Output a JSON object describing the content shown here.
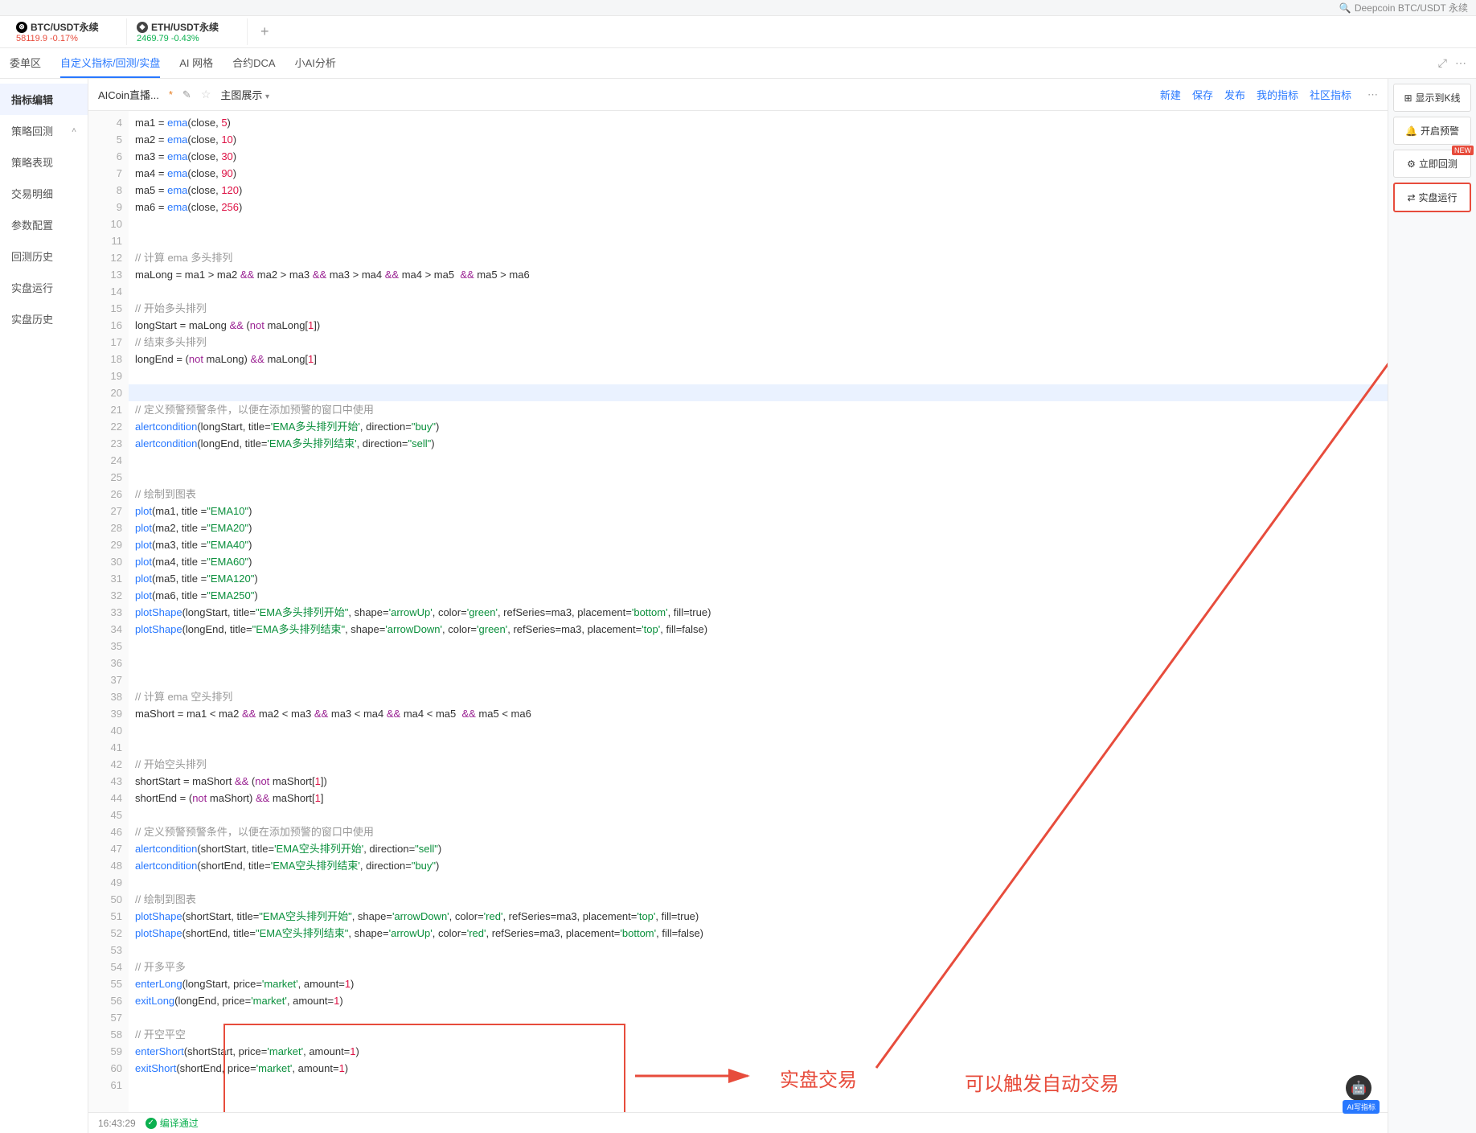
{
  "search": {
    "placeholder": "Deepcoin BTC/USDT 永续"
  },
  "pairs": [
    {
      "name": "BTC/USDT永续",
      "price": "58119.9",
      "change": "-0.17%",
      "cls": "red"
    },
    {
      "name": "ETH/USDT永续",
      "price": "2469.79",
      "change": "-0.43%",
      "cls": "green"
    }
  ],
  "menu": {
    "items": [
      "委单区",
      "自定义指标/回测/实盘",
      "AI 网格",
      "合约DCA",
      "小AI分析"
    ],
    "activeIndex": 1
  },
  "sidebar": {
    "items": [
      "指标编辑",
      "策略回测",
      "策略表现",
      "交易明细",
      "参数配置",
      "回测历史",
      "实盘运行",
      "实盘历史"
    ],
    "activeIndex": 0,
    "expandIndex": 1
  },
  "toolbar": {
    "title": "AICoin直播...",
    "modified": "*",
    "mainChart": "主图展示",
    "actions": [
      "新建",
      "保存",
      "发布",
      "我的指标",
      "社区指标"
    ]
  },
  "rightPanel": {
    "buttons": [
      {
        "icon": "⊞",
        "label": "显示到K线"
      },
      {
        "icon": "🔔",
        "label": "开启预警"
      },
      {
        "icon": "⚙",
        "label": "立即回测",
        "badge": "NEW"
      },
      {
        "icon": "⇄",
        "label": "实盘运行",
        "boxed": true
      }
    ]
  },
  "status": {
    "time": "16:43:29",
    "compile": "编译通过"
  },
  "annotations": {
    "text1": "实盘交易",
    "text2": "可以触发自动交易"
  },
  "floatBot": "AI写指标",
  "code": {
    "startLine": 4,
    "lines": [
      {
        "n": 4,
        "t": "ma1 = <fn>ema</fn>(close, <num>5</num>)"
      },
      {
        "n": 5,
        "t": "ma2 = <fn>ema</fn>(close, <num>10</num>)"
      },
      {
        "n": 6,
        "t": "ma3 = <fn>ema</fn>(close, <num>30</num>)"
      },
      {
        "n": 7,
        "t": "ma4 = <fn>ema</fn>(close, <num>90</num>)"
      },
      {
        "n": 8,
        "t": "ma5 = <fn>ema</fn>(close, <num>120</num>)"
      },
      {
        "n": 9,
        "t": "ma6 = <fn>ema</fn>(close, <num>256</num>)"
      },
      {
        "n": 10,
        "t": ""
      },
      {
        "n": 11,
        "t": ""
      },
      {
        "n": 12,
        "t": "<cm>// 计算 ema 多头排列</cm>"
      },
      {
        "n": 13,
        "t": "maLong = ma1 > ma2 <kw>&&</kw> ma2 > ma3 <kw>&&</kw> ma3 > ma4 <kw>&&</kw> ma4 > ma5  <kw>&&</kw> ma5 > ma6"
      },
      {
        "n": 14,
        "t": ""
      },
      {
        "n": 15,
        "t": "<cm>// 开始多头排列</cm>"
      },
      {
        "n": 16,
        "t": "longStart = maLong <kw>&&</kw> (<kw>not</kw> maLong[<num>1</num>])"
      },
      {
        "n": 17,
        "t": "<cm>// 结束多头排列</cm>"
      },
      {
        "n": 18,
        "t": "longEnd = (<kw>not</kw> maLong) <kw>&&</kw> maLong[<num>1</num>]"
      },
      {
        "n": 19,
        "t": ""
      },
      {
        "n": 20,
        "t": "",
        "hl": true
      },
      {
        "n": 21,
        "t": "<cm>// 定义预警预警条件，以便在添加预警的窗口中使用</cm>"
      },
      {
        "n": 22,
        "t": "<fn>alertcondition</fn>(longStart, title=<str>'EMA多头排列开始'</str>, direction=<str>\"buy\"</str>)"
      },
      {
        "n": 23,
        "t": "<fn>alertcondition</fn>(longEnd, title=<str>'EMA多头排列结束'</str>, direction=<str>\"sell\"</str>)"
      },
      {
        "n": 24,
        "t": ""
      },
      {
        "n": 25,
        "t": ""
      },
      {
        "n": 26,
        "t": "<cm>// 绘制到图表</cm>"
      },
      {
        "n": 27,
        "t": "<fn>plot</fn>(ma1, title =<str>\"EMA10\"</str>)"
      },
      {
        "n": 28,
        "t": "<fn>plot</fn>(ma2, title =<str>\"EMA20\"</str>)"
      },
      {
        "n": 29,
        "t": "<fn>plot</fn>(ma3, title =<str>\"EMA40\"</str>)"
      },
      {
        "n": 30,
        "t": "<fn>plot</fn>(ma4, title =<str>\"EMA60\"</str>)"
      },
      {
        "n": 31,
        "t": "<fn>plot</fn>(ma5, title =<str>\"EMA120\"</str>)"
      },
      {
        "n": 32,
        "t": "<fn>plot</fn>(ma6, title =<str>\"EMA250\"</str>)"
      },
      {
        "n": 33,
        "t": "<fn>plotShape</fn>(longStart, title=<str>\"EMA多头排列开始\"</str>, shape=<str>'arrowUp'</str>, color=<str>'green'</str>, refSeries=ma3, placement=<str>'bottom'</str>, fill=true)"
      },
      {
        "n": 34,
        "t": "<fn>plotShape</fn>(longEnd, title=<str>\"EMA多头排列结束\"</str>, shape=<str>'arrowDown'</str>, color=<str>'green'</str>, refSeries=ma3, placement=<str>'top'</str>, fill=false)"
      },
      {
        "n": 35,
        "t": ""
      },
      {
        "n": 36,
        "t": ""
      },
      {
        "n": 37,
        "t": ""
      },
      {
        "n": 38,
        "t": "<cm>// 计算 ema 空头排列</cm>"
      },
      {
        "n": 39,
        "t": "maShort = ma1 < ma2 <kw>&&</kw> ma2 < ma3 <kw>&&</kw> ma3 < ma4 <kw>&&</kw> ma4 < ma5  <kw>&&</kw> ma5 < ma6"
      },
      {
        "n": 40,
        "t": ""
      },
      {
        "n": 41,
        "t": ""
      },
      {
        "n": 42,
        "t": "<cm>// 开始空头排列</cm>"
      },
      {
        "n": 43,
        "t": "shortStart = maShort <kw>&&</kw> (<kw>not</kw> maShort[<num>1</num>])"
      },
      {
        "n": 44,
        "t": "shortEnd = (<kw>not</kw> maShort) <kw>&&</kw> maShort[<num>1</num>]"
      },
      {
        "n": 45,
        "t": ""
      },
      {
        "n": 46,
        "t": "<cm>// 定义预警预警条件，以便在添加预警的窗口中使用</cm>"
      },
      {
        "n": 47,
        "t": "<fn>alertcondition</fn>(shortStart, title=<str>'EMA空头排列开始'</str>, direction=<str>\"sell\"</str>)"
      },
      {
        "n": 48,
        "t": "<fn>alertcondition</fn>(shortEnd, title=<str>'EMA空头排列结束'</str>, direction=<str>\"buy\"</str>)"
      },
      {
        "n": 49,
        "t": ""
      },
      {
        "n": 50,
        "t": "<cm>// 绘制到图表</cm>"
      },
      {
        "n": 51,
        "t": "<fn>plotShape</fn>(shortStart, title=<str>\"EMA空头排列开始\"</str>, shape=<str>'arrowDown'</str>, color=<str>'red'</str>, refSeries=ma3, placement=<str>'top'</str>, fill=true)"
      },
      {
        "n": 52,
        "t": "<fn>plotShape</fn>(shortEnd, title=<str>\"EMA空头排列结束\"</str>, shape=<str>'arrowUp'</str>, color=<str>'red'</str>, refSeries=ma3, placement=<str>'bottom'</str>, fill=false)"
      },
      {
        "n": 53,
        "t": ""
      },
      {
        "n": 54,
        "t": "<cm>// 开多平多</cm>"
      },
      {
        "n": 55,
        "t": "<fn>enterLong</fn>(longStart, price=<str>'market'</str>, amount=<num>1</num>)"
      },
      {
        "n": 56,
        "t": "<fn>exitLong</fn>(longEnd, price=<str>'market'</str>, amount=<num>1</num>)"
      },
      {
        "n": 57,
        "t": ""
      },
      {
        "n": 58,
        "t": "<cm>// 开空平空</cm>"
      },
      {
        "n": 59,
        "t": "<fn>enterShort</fn>(shortStart, price=<str>'market'</str>, amount=<num>1</num>)"
      },
      {
        "n": 60,
        "t": "<fn>exitShort</fn>(shortEnd, price=<str>'market'</str>, amount=<num>1</num>)"
      },
      {
        "n": 61,
        "t": ""
      }
    ]
  }
}
